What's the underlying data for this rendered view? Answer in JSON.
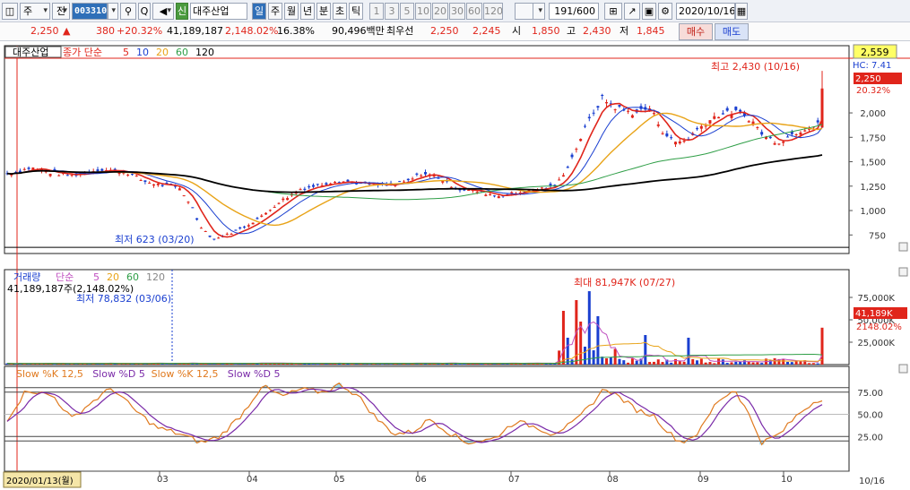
{
  "toolbar": {
    "market_select": "주",
    "prev_label": "전",
    "stock_code": "003310",
    "badge_new": "신",
    "stock_name": "대주산업",
    "period_tabs": [
      "일",
      "주",
      "월",
      "년",
      "분",
      "초",
      "틱"
    ],
    "number_tabs": [
      "1",
      "3",
      "5",
      "10",
      "20",
      "30",
      "60",
      "120"
    ],
    "count": "191/600",
    "date": "2020/10/16"
  },
  "quote": {
    "price": "2,250",
    "change": "380",
    "change_pct": "+20.32%",
    "volume": "41,189,187",
    "volume_pct": "2,148.02%",
    "turnover_pct": "16.38%",
    "amount": "90,496백만",
    "hoga_label": "최우선",
    "ask": "2,250",
    "bid": "2,245",
    "open_label": "시",
    "open": "1,850",
    "high_label": "고",
    "high": "2,430",
    "low_label": "저",
    "low": "1,845",
    "buy_label": "매수",
    "sell_label": "매도"
  },
  "price_panel": {
    "legend_name": "대주산업",
    "legend_title": "종가 단순",
    "ma_periods": [
      "5",
      "10",
      "20",
      "60",
      "120"
    ],
    "high_annotation": "최고 2,430 (10/16)",
    "low_annotation": "최저 623 (03/20)",
    "tag_top": "2,559",
    "tag_hc": "HC: 7.41",
    "tag_price": "2,250",
    "tag_pct": "20.32%",
    "y_ticks": [
      "2,000",
      "1,750",
      "1,500",
      "1,250",
      "1,000",
      "750"
    ]
  },
  "volume_panel": {
    "legend_name": "거래량",
    "legend_title": "단순",
    "ma_periods": [
      "5",
      "20",
      "60",
      "120"
    ],
    "current_text": "41,189,187주(2,148.02%)",
    "min_annotation": "최저 78,832 (03/06)",
    "max_annotation": "최대 81,947K (07/27)",
    "tag_vol": "41,189K",
    "tag_pct": "2148.02%",
    "y_ticks": [
      "75,000K",
      "50,000K",
      "25,000K"
    ]
  },
  "stoch_panel": {
    "legend": [
      "Slow %K 12,5",
      "Slow %D 5",
      "Slow %K 12,5",
      "Slow %D 5"
    ],
    "y_ticks": [
      "75.00",
      "50.00",
      "25.00"
    ]
  },
  "x_axis": {
    "start_label": "2020/01/13(월)",
    "months": [
      "03",
      "04",
      "05",
      "06",
      "07",
      "08",
      "09",
      "10"
    ],
    "end_label": "10/16"
  },
  "colors": {
    "up": "#e0251b",
    "down": "#1a3fd0",
    "ma5": "#e0251b",
    "ma10": "#1a3fd0",
    "ma20": "#e8a317",
    "ma60": "#2e9e46",
    "ma120": "#000000",
    "slowk": "#e07a1f",
    "slowd": "#7a2aa8"
  },
  "chart_data": {
    "type": "candlestick",
    "date_range": [
      "2020/01/13",
      "2020/10/16"
    ],
    "close_approx": [
      {
        "date": "2020-01-13",
        "close": 1380
      },
      {
        "date": "2020-02-03",
        "close": 1420
      },
      {
        "date": "2020-03-02",
        "close": 1200
      },
      {
        "date": "2020-03-20",
        "close": 700
      },
      {
        "date": "2020-04-01",
        "close": 900
      },
      {
        "date": "2020-05-01",
        "close": 1280
      },
      {
        "date": "2020-06-01",
        "close": 1350
      },
      {
        "date": "2020-07-01",
        "close": 1180
      },
      {
        "date": "2020-07-27",
        "close": 2250
      },
      {
        "date": "2020-08-03",
        "close": 2000
      },
      {
        "date": "2020-09-01",
        "close": 2020
      },
      {
        "date": "2020-09-21",
        "close": 1700
      },
      {
        "date": "2020-10-16",
        "close": 2250
      }
    ],
    "high": {
      "value": 2430,
      "date": "10/16"
    },
    "low": {
      "value": 623,
      "date": "03/20"
    },
    "volume_max": {
      "value": 81947,
      "unit": "K",
      "date": "07/27"
    },
    "volume_min": {
      "value": 78832,
      "date": "03/06"
    },
    "last_volume": 41189187
  }
}
